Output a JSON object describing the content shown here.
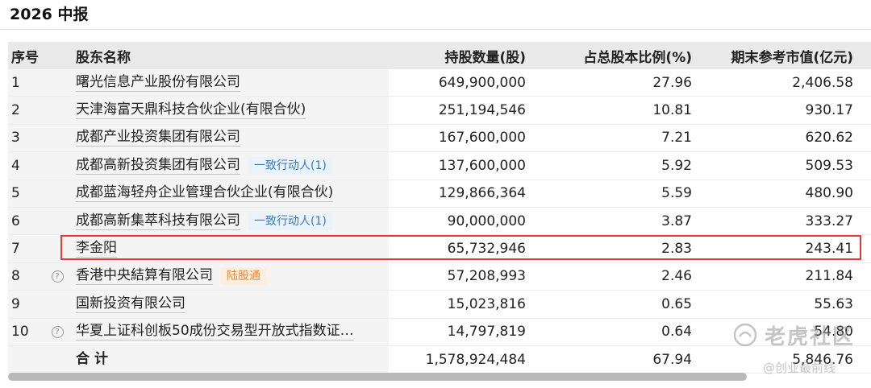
{
  "section_title": "2026 中报",
  "table": {
    "headers": {
      "no": "序号",
      "name": "股东名称",
      "shares": "持股数量(股)",
      "ratio": "占总股本比例(%)",
      "value": "期末参考市值(亿元)"
    },
    "rows": [
      {
        "no": "1",
        "name": "曙光信息产业股份有限公司",
        "tag": "",
        "help": false,
        "shares": "649,900,000",
        "ratio": "27.96",
        "value": "2,406.58"
      },
      {
        "no": "2",
        "name": "天津海富天鼎科技合伙企业(有限合伙)",
        "tag": "",
        "help": false,
        "shares": "251,194,546",
        "ratio": "10.81",
        "value": "930.17"
      },
      {
        "no": "3",
        "name": "成都产业投资集团有限公司",
        "tag": "",
        "help": false,
        "shares": "167,600,000",
        "ratio": "7.21",
        "value": "620.62"
      },
      {
        "no": "4",
        "name": "成都高新投资集团有限公司",
        "tag": "一致行动人(1)",
        "tag_style": "blue",
        "help": false,
        "shares": "137,600,000",
        "ratio": "5.92",
        "value": "509.53"
      },
      {
        "no": "5",
        "name": "成都蓝海轻舟企业管理合伙企业(有限合伙)",
        "tag": "",
        "help": false,
        "shares": "129,866,364",
        "ratio": "5.59",
        "value": "480.90"
      },
      {
        "no": "6",
        "name": "成都高新集萃科技有限公司",
        "tag": "一致行动人(1)",
        "tag_style": "blue",
        "help": false,
        "shares": "90,000,000",
        "ratio": "3.87",
        "value": "333.27"
      },
      {
        "no": "7",
        "name": "李金阳",
        "tag": "",
        "help": false,
        "shares": "65,732,946",
        "ratio": "2.83",
        "value": "243.41"
      },
      {
        "no": "8",
        "name": "香港中央結算有限公司",
        "tag": "陆股通",
        "tag_style": "orange",
        "help": true,
        "shares": "57,208,993",
        "ratio": "2.46",
        "value": "211.84"
      },
      {
        "no": "9",
        "name": "国新投资有限公司",
        "tag": "",
        "help": false,
        "shares": "15,023,816",
        "ratio": "0.65",
        "value": "55.63"
      },
      {
        "no": "10",
        "name": "华夏上证科创板50成份交易型开放式指数证…",
        "tag": "",
        "help": true,
        "shares": "14,797,819",
        "ratio": "0.64",
        "value": "54.80"
      }
    ],
    "total": {
      "label": "合计",
      "shares": "1,578,924,484",
      "ratio": "67.94",
      "value": "5,846.76"
    }
  },
  "highlight_row_index": 6,
  "help_icon_glyph": "?",
  "watermark": {
    "main": "老虎社区",
    "sub": "@创业最前线"
  },
  "colors": {
    "highlight": "#e53935",
    "tag_blue": "#3b7bbd",
    "tag_orange": "#e8893a"
  }
}
